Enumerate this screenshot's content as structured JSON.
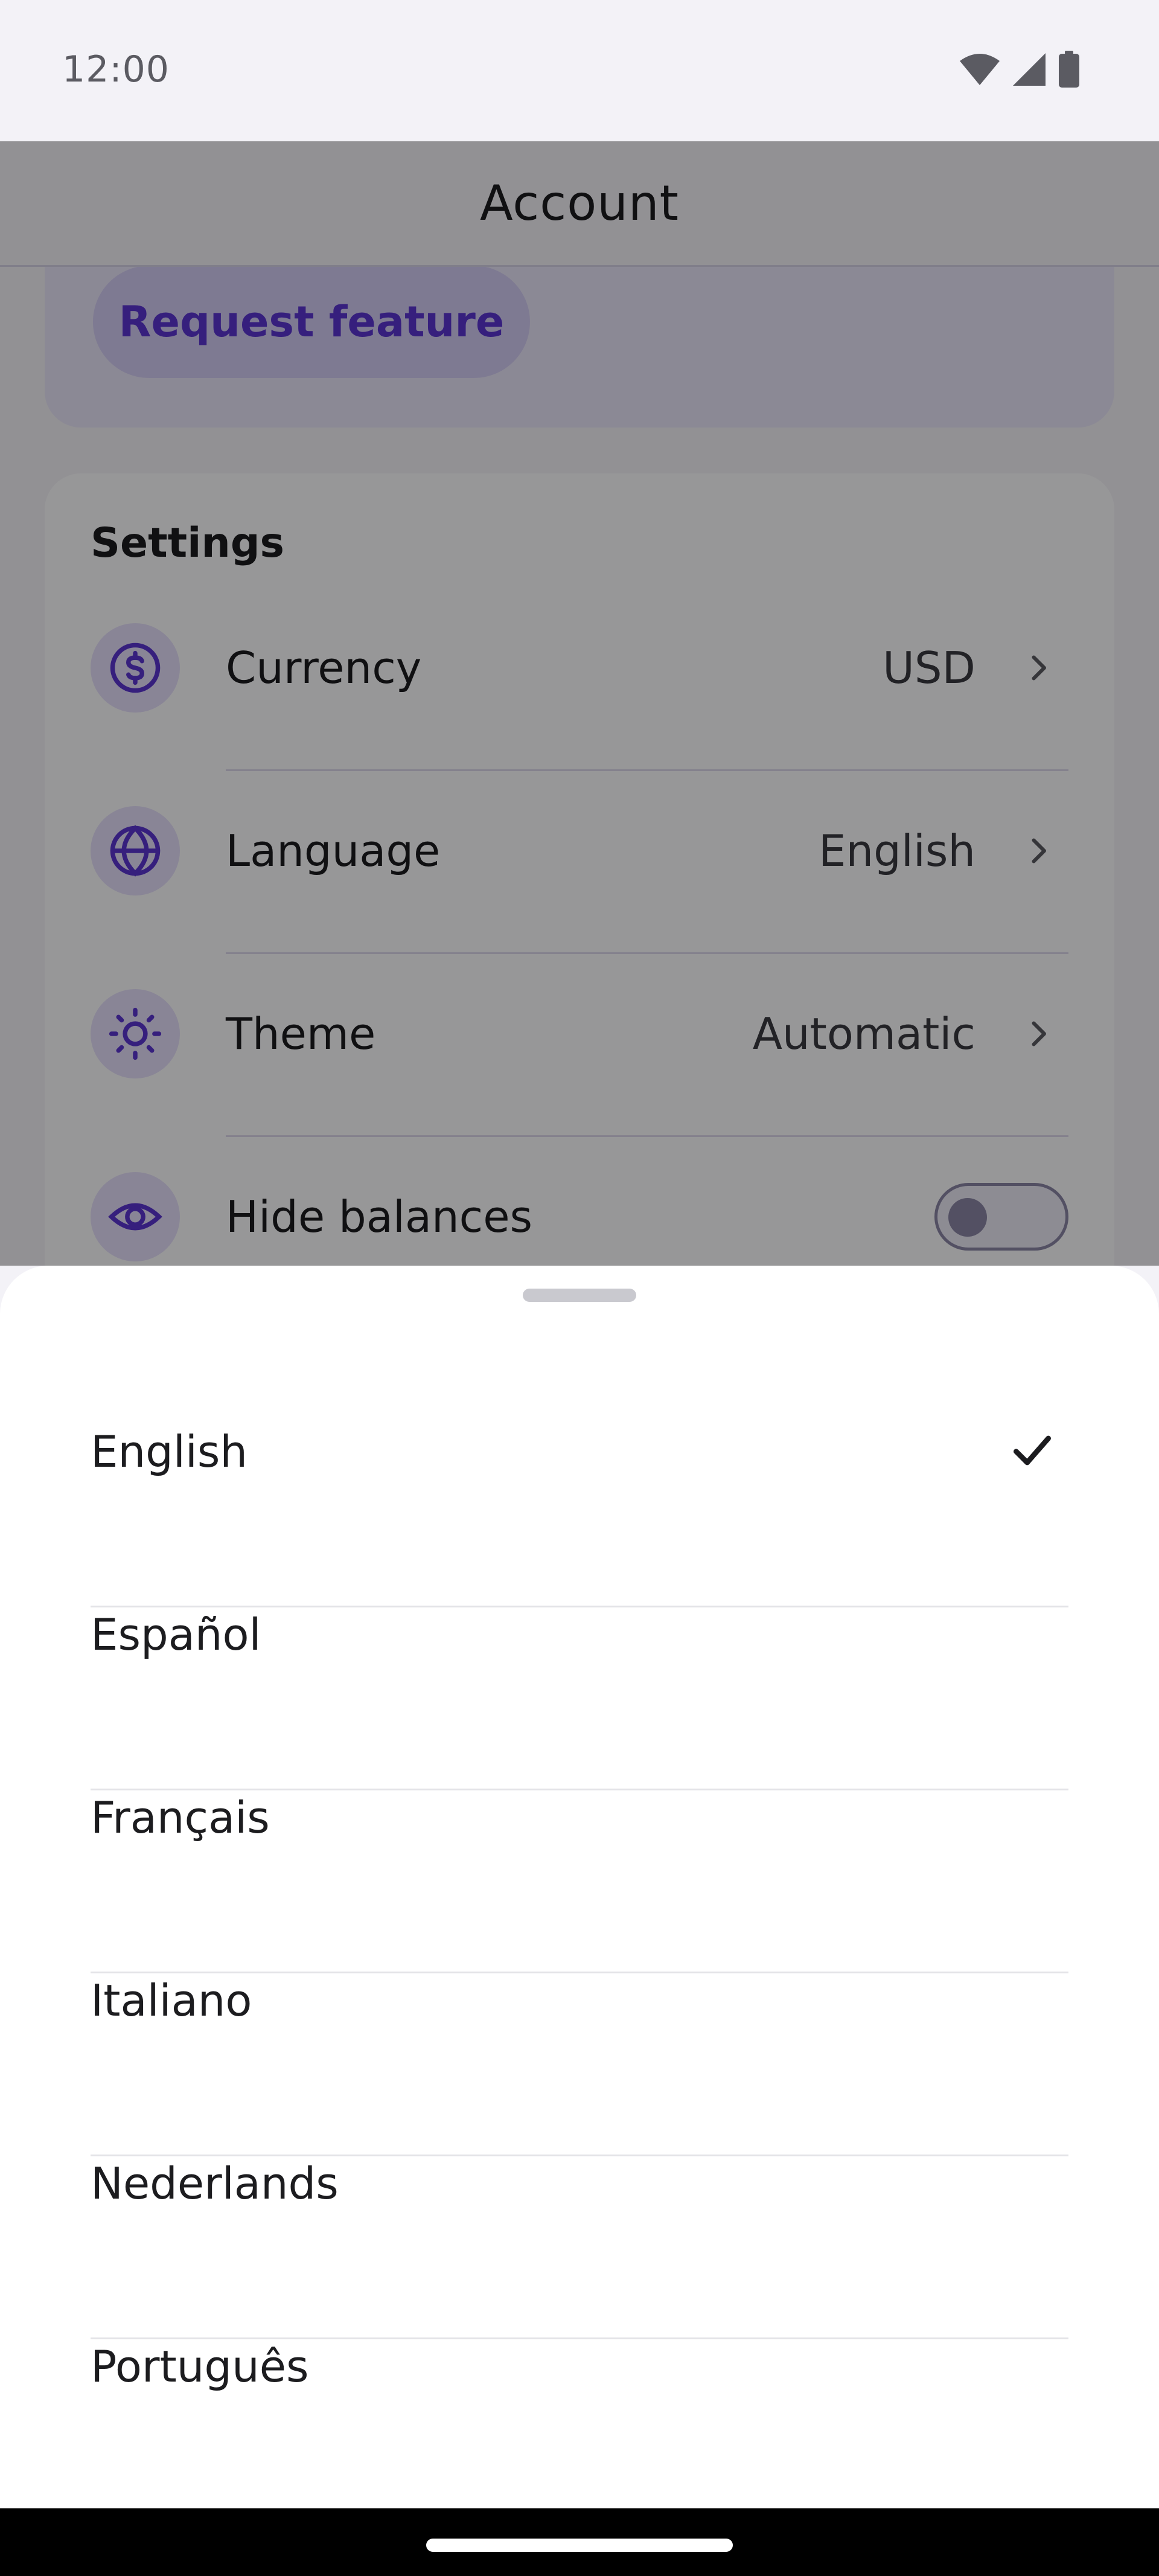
{
  "status_bar": {
    "time": "12:00"
  },
  "header": {
    "title": "Account"
  },
  "feedback": {
    "request_feature_label": "Request feature"
  },
  "settings": {
    "heading": "Settings",
    "rows": [
      {
        "label": "Currency",
        "value": "USD",
        "icon": "dollar-circle-icon"
      },
      {
        "label": "Language",
        "value": "English",
        "icon": "globe-icon"
      },
      {
        "label": "Theme",
        "value": "Automatic",
        "icon": "sun-icon"
      },
      {
        "label": "Hide balances",
        "toggle_on": false,
        "icon": "eye-icon"
      }
    ]
  },
  "language_sheet": {
    "options": [
      {
        "label": "English",
        "selected": true
      },
      {
        "label": "Español",
        "selected": false
      },
      {
        "label": "Français",
        "selected": false
      },
      {
        "label": "Italiano",
        "selected": false
      },
      {
        "label": "Nederlands",
        "selected": false
      },
      {
        "label": "Português",
        "selected": false
      }
    ]
  },
  "colors": {
    "accent": "#5a34d0",
    "background": "#f3f2f7",
    "sheet": "#ffffff",
    "text": "#1c1c1f"
  }
}
